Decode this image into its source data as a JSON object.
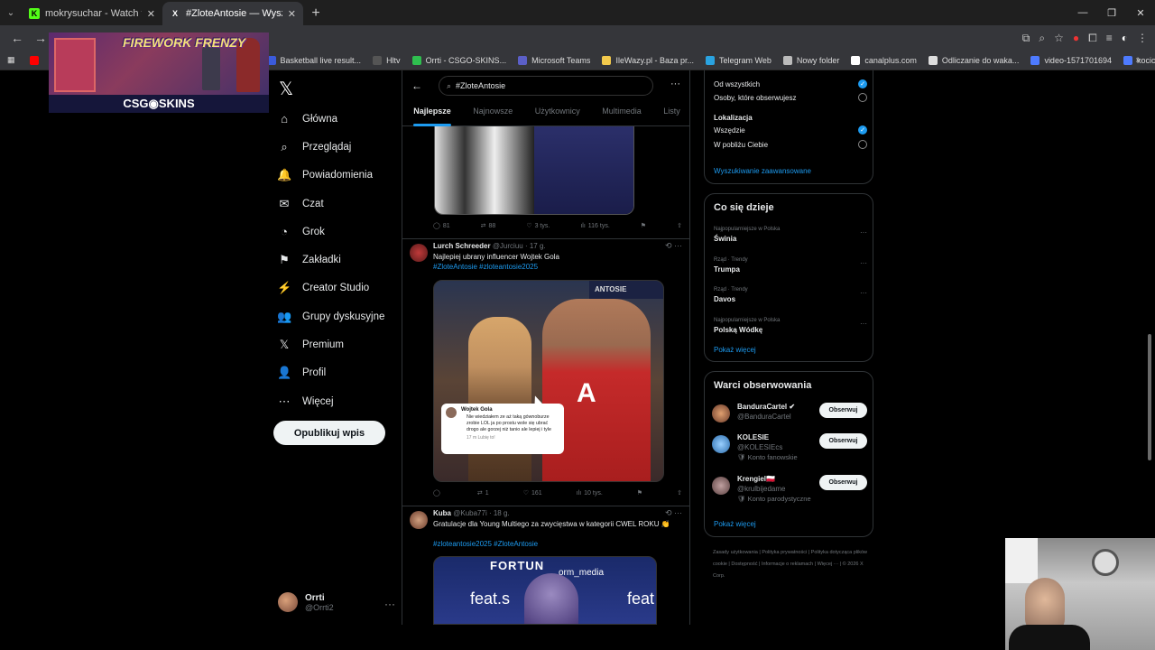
{
  "browser": {
    "tabs": [
      {
        "title": "mokrysuchar - Watch the VOD",
        "fav": "K",
        "fav_color": "#53fc18"
      },
      {
        "title": "#ZloteAntosie — Wyszukiwanie",
        "fav": "X",
        "fav_color": "#000000"
      }
    ],
    "new_tab": "+",
    "bookmarks": [
      {
        "label": "Basketball live result...",
        "color": "#3b5bdb"
      },
      {
        "label": "Hltv",
        "color": "#555"
      },
      {
        "label": "Orrti - CSGO-SKINS...",
        "color": "#2fbf4f"
      },
      {
        "label": "Microsoft Teams",
        "color": "#5b5fc7"
      },
      {
        "label": "IleWazy.pl - Baza pr...",
        "color": "#f2c94c"
      },
      {
        "label": "Telegram Web",
        "color": "#2aa3e0"
      },
      {
        "label": "Nowy folder",
        "color": "#bbbbbb"
      },
      {
        "label": "canalplus.com",
        "color": "#ffffff"
      },
      {
        "label": "Odliczanie do waka...",
        "color": "#dddddd"
      },
      {
        "label": "video-1571701694",
        "color": "#4e7bff"
      },
      {
        "label": "kocica",
        "color": "#4e7bff"
      }
    ]
  },
  "promo": {
    "title": "FIREWORK FRENZY",
    "brand": "CSG◉SKINS"
  },
  "nav": {
    "logo": "𝕏",
    "items": [
      {
        "icon": "⌂",
        "label": "Główna"
      },
      {
        "icon": "⌕",
        "label": "Przeglądaj"
      },
      {
        "icon": "🔔",
        "label": "Powiadomienia"
      },
      {
        "icon": "✉",
        "label": "Czat"
      },
      {
        "icon": "◔",
        "label": "Grok"
      },
      {
        "icon": "⚑",
        "label": "Zakładki"
      },
      {
        "icon": "⚡",
        "label": "Creator Studio"
      },
      {
        "icon": "👥",
        "label": "Grupy dyskusyjne"
      },
      {
        "icon": "𝕏",
        "label": "Premium"
      },
      {
        "icon": "👤",
        "label": "Profil"
      },
      {
        "icon": "⋯",
        "label": "Więcej"
      }
    ],
    "post_button": "Opublikuj wpis",
    "account": {
      "name": "Orrti",
      "handle": "@Orrti2",
      "more": "···"
    }
  },
  "search": {
    "query": "#ZloteAntosie",
    "tabs": [
      "Najlepsze",
      "Najnowsze",
      "Użytkownicy",
      "Multimedia",
      "Listy"
    ],
    "active_tab": "Najlepsze"
  },
  "tweets": [
    {
      "stats": {
        "replies": "81",
        "retweets": "88",
        "likes": "3 tys.",
        "views": "116 tys."
      }
    },
    {
      "author": "Lurch Schreeder",
      "handle": "@Jurciuu",
      "time": "· 17 g.",
      "text": "Najlepiej ubrany influencer Wojtek Gola",
      "hashtags": "#ZloteAntosie #zloteantosie2025",
      "image": {
        "watermark": "ANTOSIE",
        "comment_author": "Wojtek Gola",
        "comment_text": "Nie wiedziałem ze aż taką gównoburze zrobie LOL ja po prostu wole się ubrać drogo ale gorzej niż tanio ale lepiej i tyle",
        "comment_footer": "17 m      Lubię to!"
      },
      "stats": {
        "replies": "",
        "retweets": "1",
        "likes": "161",
        "views": "10 tys."
      }
    },
    {
      "author": "Kuba",
      "handle": "@Kuba77i",
      "time": "· 18 g.",
      "text": "Gratulacje dla Young Multiego za zwycięstwa w kategorii CWEL ROKU 👏",
      "hashtags": "#zloteantosie2025 #ZloteAntosie",
      "image": {
        "brand": "FORTUN",
        "media": "orm_media",
        "feat": "feat.s",
        "feat2": "feat"
      }
    }
  ],
  "filters": {
    "people_options": [
      "Od wszystkich",
      "Osoby, które obserwujesz"
    ],
    "location_title": "Lokalizacja",
    "location_options": [
      "Wszędzie",
      "W pobliżu Ciebie"
    ],
    "advanced_link": "Wyszukiwanie zaawansowane"
  },
  "trends": {
    "title": "Co się dzieje",
    "items": [
      {
        "meta": "Najpopularniejsze w Polska",
        "name": "Świnia"
      },
      {
        "meta": "Rząd · Trendy",
        "name": "Trumpa"
      },
      {
        "meta": "Rząd · Trendy",
        "name": "Davos"
      },
      {
        "meta": "Najpopularniejsze w Polska",
        "name": "Polską Wódkę"
      }
    ],
    "more": "Pokaż więcej"
  },
  "who_to_follow": {
    "title": "Warci obserwowania",
    "items": [
      {
        "name": "BanduraCartel ✔",
        "handle": "@BanduraCartel",
        "label": "",
        "button": "Obserwuj"
      },
      {
        "name": "KOLESIE",
        "handle": "@KOLESIEcs",
        "label": "🛡 Konto fanowskie",
        "button": "Obserwuj"
      },
      {
        "name": "Krengiel🇵🇱",
        "handle": "@krulbijedame",
        "label": "🛡 Konto parodystyczne",
        "button": "Obserwuj"
      }
    ],
    "more": "Pokaż więcej"
  },
  "footer": {
    "links": [
      "Zasady użytkowania",
      "Polityka prywatności",
      "Polityka dotycząca plików cookie",
      "Dostępność",
      "Informacje o reklamach",
      "Więcej ···",
      "© 2026 X Corp."
    ]
  }
}
